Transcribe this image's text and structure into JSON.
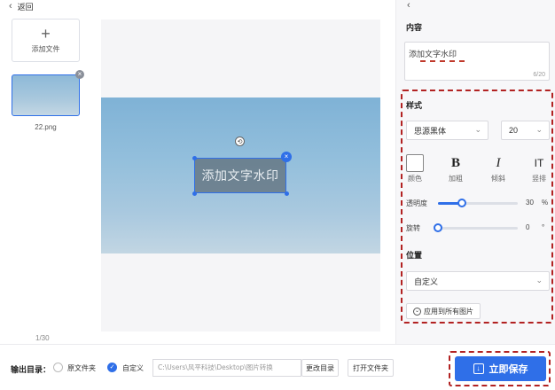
{
  "header": {
    "back_label": "返回"
  },
  "files": {
    "add_label": "添加文件",
    "items": [
      {
        "name": "22.png"
      }
    ],
    "pager": "1/30"
  },
  "canvas": {
    "watermark_text": "添加文字水印"
  },
  "panel": {
    "content": {
      "title": "内容",
      "value": "添加文字水印",
      "count": "6/20"
    },
    "style": {
      "title": "样式",
      "font_family": "思源黑体",
      "font_size": "20",
      "tools": {
        "color": "颜色",
        "bold": "加粗",
        "italic": "倾斜",
        "vertical": "竖排",
        "bold_icon": "B",
        "italic_icon": "I",
        "vertical_icon": "IT"
      },
      "opacity": {
        "label": "透明度",
        "value": "30",
        "unit": "%",
        "fraction": 0.3
      },
      "rotation": {
        "label": "旋转",
        "value": "0",
        "unit": "°",
        "fraction": 0.0
      }
    },
    "position": {
      "title": "位置",
      "value": "自定义",
      "apply_all": "应用到所有图片"
    }
  },
  "output": {
    "label": "输出目录：",
    "option_original": "原文件夹",
    "option_custom": "自定义",
    "path": "C:\\Users\\风平科技\\Desktop\\图片转换",
    "change_dir": "更改目录",
    "open_folder": "打开文件夹",
    "save": "立即保存"
  },
  "colors": {
    "accent": "#2f6fe8",
    "annotation_red": "#b22222"
  }
}
